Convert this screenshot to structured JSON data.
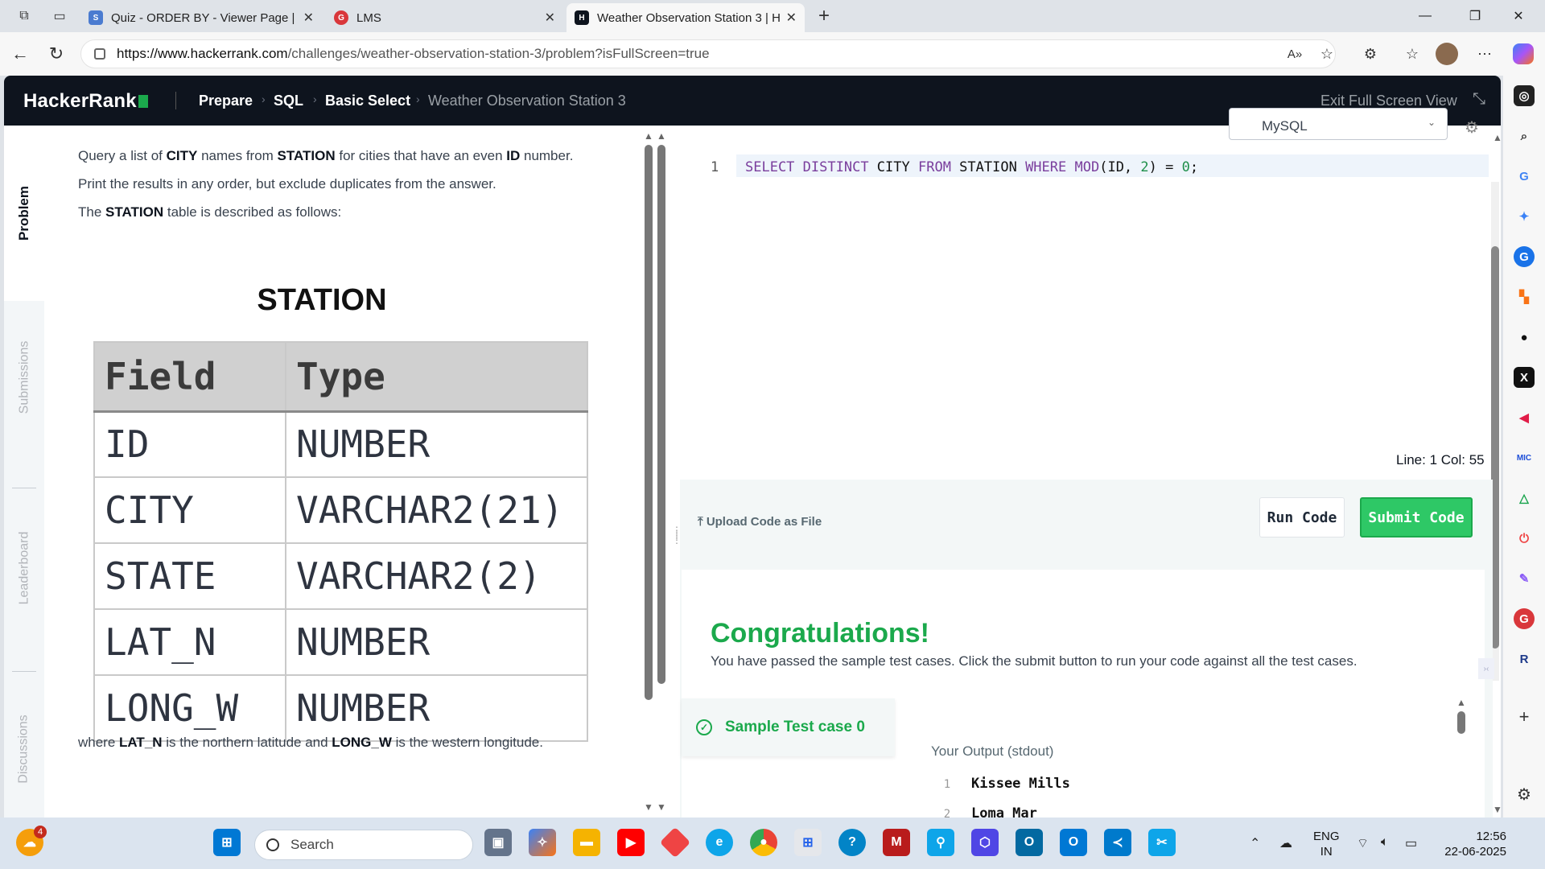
{
  "browser": {
    "tabs": [
      {
        "title": "Quiz - ORDER BY - Viewer Page | I",
        "favicon": "quiz-favicon",
        "color": "#4a7bd0"
      },
      {
        "title": "LMS",
        "favicon": "lms-favicon",
        "color": "#d9373b"
      },
      {
        "title": "Weather Observation Station 3 | H",
        "favicon": "hackerrank-favicon",
        "color": "#0e141e"
      }
    ],
    "new_tab": "+",
    "url_host": "https://www.hackerrank.com",
    "url_path": "/challenges/weather-observation-station-3/problem?isFullScreen=true"
  },
  "hr": {
    "logo": "HackerRank",
    "breadcrumbs": [
      "Prepare",
      "SQL",
      "Basic Select",
      "Weather Observation Station 3"
    ],
    "exit_fullscreen": "Exit Full Screen View",
    "vertical_tabs": [
      "Problem",
      "Submissions",
      "Leaderboard",
      "Discussions"
    ]
  },
  "problem": {
    "line1": {
      "a": "Query a list of ",
      "b": "CITY",
      "c": " names from ",
      "d": "STATION",
      "e": " for cities that have an even ",
      "f": "ID",
      "g": " number."
    },
    "line2": "Print the results in any order, but exclude duplicates from the answer.",
    "line3": {
      "a": "The ",
      "b": "STATION",
      "c": " table is described as follows:"
    },
    "table_title": "STATION",
    "table_headers": [
      "Field",
      "Type"
    ],
    "table_rows": [
      [
        "ID",
        "NUMBER"
      ],
      [
        "CITY",
        "VARCHAR2(21)"
      ],
      [
        "STATE",
        "VARCHAR2(2)"
      ],
      [
        "LAT_N",
        "NUMBER"
      ],
      [
        "LONG_W",
        "NUMBER"
      ]
    ],
    "footer": {
      "a": "where ",
      "b": "LAT_N",
      "c": " is the northern latitude and ",
      "d": "LONG_W",
      "e": " is the western longitude."
    }
  },
  "editor": {
    "language": "MySQL",
    "line_number": "1",
    "code_tokens": [
      {
        "t": "SELECT",
        "k": "kw"
      },
      {
        "t": " ",
        "k": ""
      },
      {
        "t": "DISTINCT",
        "k": "kw"
      },
      {
        "t": " CITY ",
        "k": ""
      },
      {
        "t": "FROM",
        "k": "kw"
      },
      {
        "t": " STATION ",
        "k": ""
      },
      {
        "t": "WHERE",
        "k": "kw"
      },
      {
        "t": " ",
        "k": ""
      },
      {
        "t": "MOD",
        "k": "kw"
      },
      {
        "t": "(ID, ",
        "k": ""
      },
      {
        "t": "2",
        "k": "num"
      },
      {
        "t": ") = ",
        "k": ""
      },
      {
        "t": "0",
        "k": "num"
      },
      {
        "t": ";",
        "k": ""
      }
    ],
    "line_col": "Line: 1 Col: 55",
    "upload_label": "Upload Code as File",
    "run_label": "Run Code",
    "submit_label": "Submit Code"
  },
  "results": {
    "title": "Congratulations!",
    "subtitle": "You have passed the sample test cases. Click the submit button to run your code against all the test cases.",
    "testcase_label": "Sample Test case 0",
    "output_label": "Your Output (stdout)",
    "output_lines": [
      {
        "n": "1",
        "v": "Kissee Mills"
      },
      {
        "n": "2",
        "v": "Loma Mar"
      }
    ]
  },
  "taskbar": {
    "search_placeholder": "Search",
    "notification_count": "4",
    "lang_line1": "ENG",
    "lang_line2": "IN",
    "time": "12:56",
    "date": "22-06-2025"
  }
}
